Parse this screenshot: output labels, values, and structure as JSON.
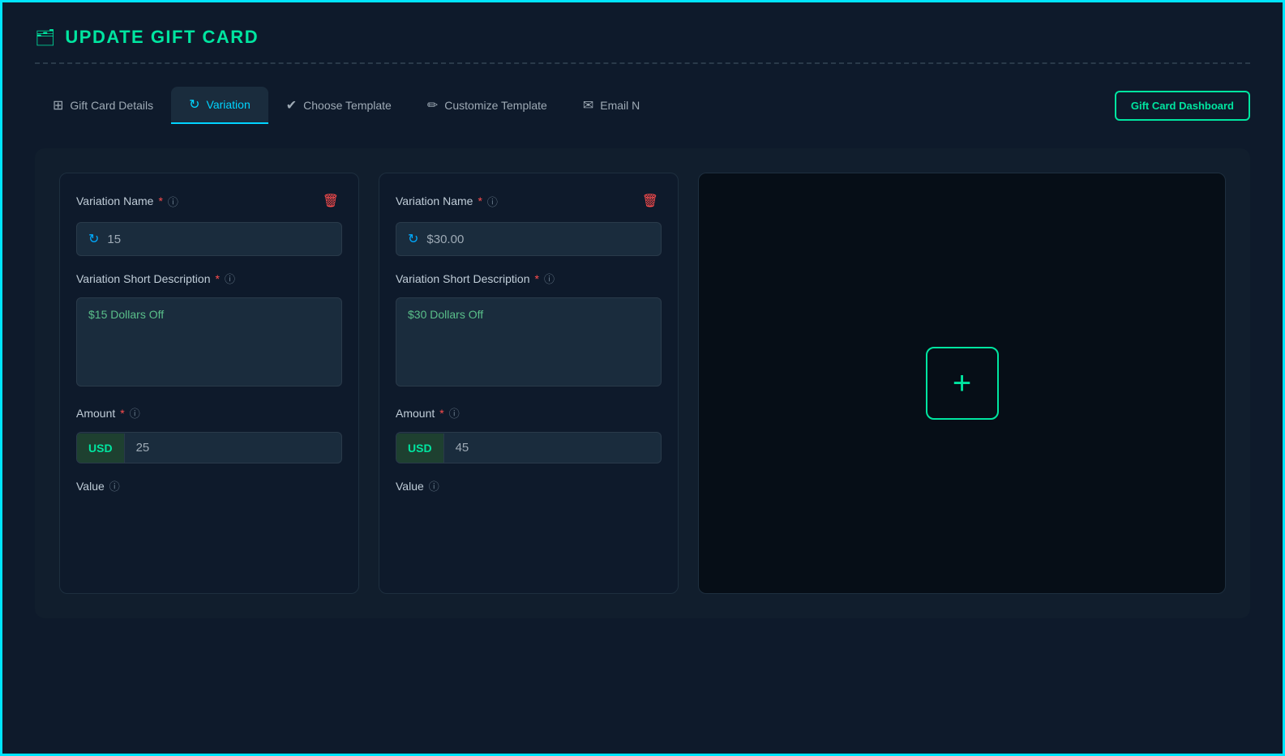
{
  "page": {
    "title": "UPDATE GIFT CARD",
    "divider": true
  },
  "tabs": [
    {
      "id": "gift-card-details",
      "label": "Gift Card Details",
      "icon": "⊞",
      "active": false
    },
    {
      "id": "variation",
      "label": "Variation",
      "icon": "↻",
      "active": true
    },
    {
      "id": "choose-template",
      "label": "Choose Template",
      "icon": "✔",
      "active": false
    },
    {
      "id": "customize-template",
      "label": "Customize Template",
      "icon": "✏",
      "active": false
    },
    {
      "id": "email-notification",
      "label": "Email N",
      "icon": "✉",
      "active": false
    }
  ],
  "dashboard_btn": "Gift Card Dashboard",
  "variations": [
    {
      "id": "variation-1",
      "name_label": "Variation Name",
      "name_value": "15",
      "short_desc_label": "Variation Short Description",
      "short_desc_value": "$15 Dollars Off",
      "amount_label": "Amount",
      "currency": "USD",
      "amount_value": "25",
      "value_label": "Value"
    },
    {
      "id": "variation-2",
      "name_label": "Variation Name",
      "name_value": "$30.00",
      "short_desc_label": "Variation Short Description",
      "short_desc_value": "$30 Dollars Off",
      "amount_label": "Amount",
      "currency": "USD",
      "amount_value": "45",
      "value_label": "Value"
    }
  ],
  "add_variation_btn": "+",
  "icons": {
    "page_icon": "🗂",
    "refresh": "↻",
    "delete": "🗑",
    "info": "ⓘ",
    "required": "*"
  },
  "colors": {
    "accent_cyan": "#00e5ff",
    "accent_green": "#00e5a0",
    "accent_blue": "#00aaff",
    "danger": "#ff4d4d",
    "text_muted": "#9eaab5",
    "bg_card": "#0e1a2b",
    "bg_content": "#111e2d"
  }
}
